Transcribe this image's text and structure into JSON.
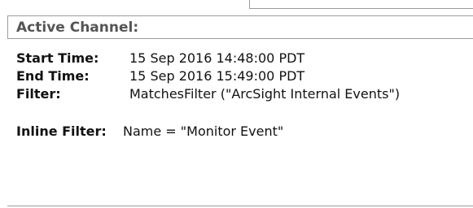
{
  "panel": {
    "title": "Active Channel:"
  },
  "details": {
    "start_time_label": "Start Time:",
    "start_time_value": "15 Sep 2016 14:48:00 PDT",
    "end_time_label": "End Time:",
    "end_time_value": "15 Sep 2016 15:49:00 PDT",
    "filter_label": "Filter:",
    "filter_value": "MatchesFilter (\"ArcSight Internal Events\")",
    "inline_filter_label": "Inline Filter:",
    "inline_filter_value": "Name = \"Monitor Event\""
  }
}
